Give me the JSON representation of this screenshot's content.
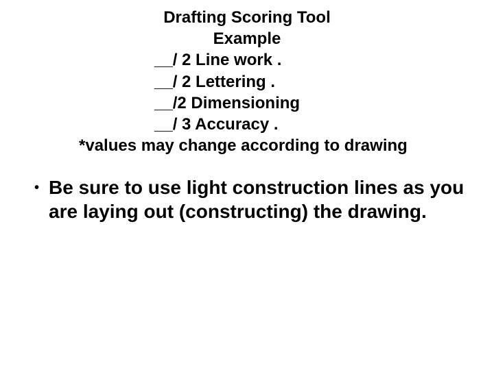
{
  "header": {
    "title1": "Drafting Scoring Tool",
    "title2": "Example",
    "score1": "__/ 2 Line work    .",
    "score2": "__/ 2 Lettering     .",
    "score3": "__/2 Dimensioning",
    "score4": "__/ 3 Accuracy     .",
    "footnote": "*values may change according to drawing"
  },
  "bullet": {
    "marker": "•",
    "text": "Be sure to use light construction lines as you are laying out (constructing) the drawing."
  }
}
